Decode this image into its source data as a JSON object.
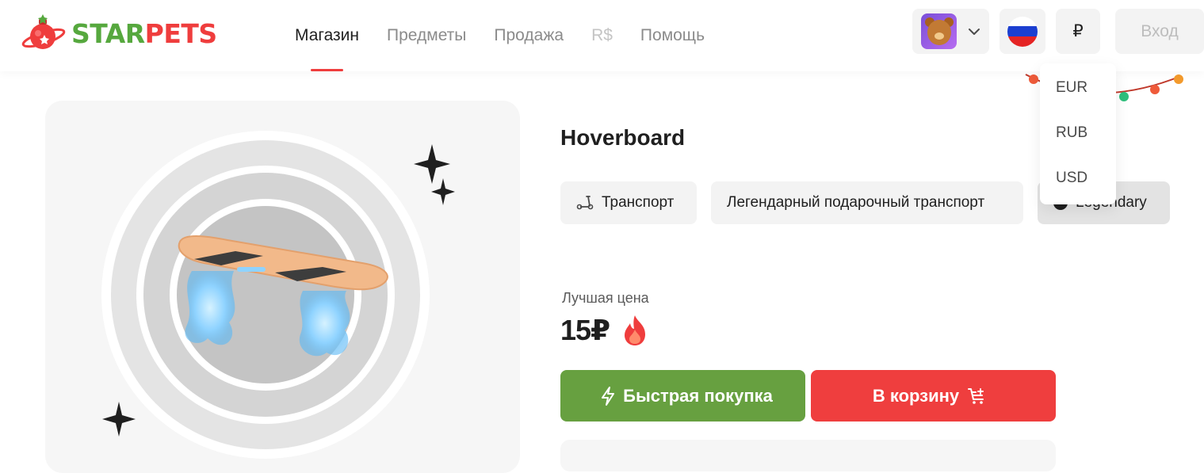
{
  "brand": {
    "logo_part1": "STAR",
    "logo_part2": "PETS",
    "green": "#56a83e",
    "red": "#ef3d3d"
  },
  "nav": {
    "items": [
      {
        "label": "Магазин",
        "state": "active"
      },
      {
        "label": "Предметы",
        "state": "normal"
      },
      {
        "label": "Продажа",
        "state": "normal"
      },
      {
        "label": "R$",
        "state": "muted"
      },
      {
        "label": "Помощь",
        "state": "normal"
      }
    ]
  },
  "header": {
    "avatar_icon": "bear-avatar-icon",
    "language_flag": "russia-flag-icon",
    "currency_symbol": "₽",
    "login_label": "Вход"
  },
  "currency_dropdown": {
    "options": [
      "EUR",
      "RUB",
      "USD"
    ]
  },
  "product": {
    "title": "Hoverboard",
    "tags": [
      {
        "label": "Транспорт",
        "icon": "scooter-icon"
      },
      {
        "label": "Легендарный подарочный транспорт"
      },
      {
        "label": "Legendary",
        "icon": "rarity-dot-icon"
      }
    ],
    "price_label": "Лучшая цена",
    "price": "15₽",
    "price_icon": "fire-icon"
  },
  "actions": {
    "quick_buy_label": "Быстрая покупка",
    "quick_buy_icon": "lightning-icon",
    "quick_buy_color": "#67a040",
    "cart_label": "В корзину",
    "cart_icon": "cart-plus-icon",
    "cart_color": "#ef3e3e"
  }
}
